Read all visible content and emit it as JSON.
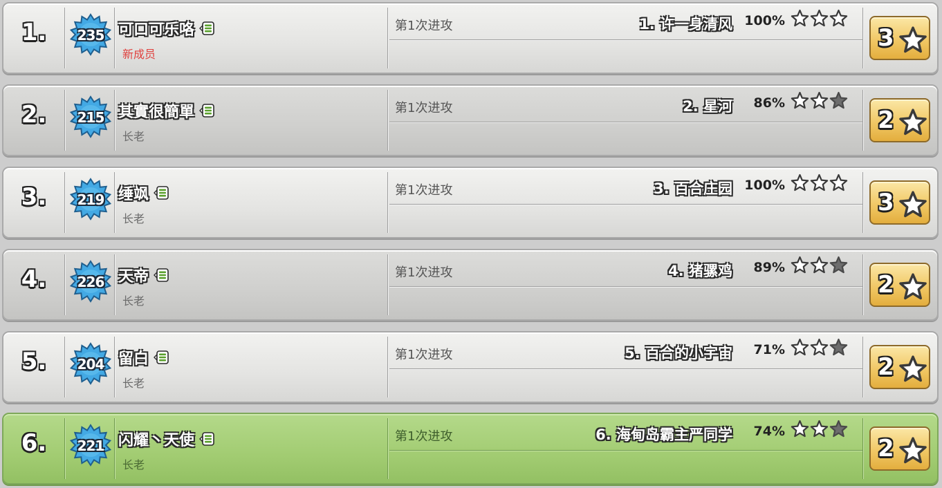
{
  "attack_label": "第1次进攻",
  "colors": {
    "badge_blue": "#43a9e4",
    "highlight_green": "#a2cc72",
    "new_member_red": "#e0413e",
    "total_gold": "#f1c866"
  },
  "icons": {
    "member_list": "list-icon",
    "level_badge": "level-badge-icon",
    "star": "star-icon"
  },
  "members": [
    {
      "rank": "1.",
      "level": "235",
      "name": "可口可乐咯",
      "role": "新成员",
      "is_new": true,
      "highlight": false,
      "target": "1. 许一身清风",
      "percent": "100%",
      "stars": 3,
      "total": "3"
    },
    {
      "rank": "2.",
      "level": "215",
      "name": "其實很簡單",
      "role": "长老",
      "is_new": false,
      "highlight": false,
      "target": "2. 星河",
      "percent": "86%",
      "stars": 2,
      "total": "2"
    },
    {
      "rank": "3.",
      "level": "219",
      "name": "缍飒",
      "role": "长老",
      "is_new": false,
      "highlight": false,
      "target": "3. 百合庄园",
      "percent": "100%",
      "stars": 3,
      "total": "3"
    },
    {
      "rank": "4.",
      "level": "226",
      "name": "天帝",
      "role": "长老",
      "is_new": false,
      "highlight": false,
      "target": "4. 猪骡鸡",
      "percent": "89%",
      "stars": 2,
      "total": "2"
    },
    {
      "rank": "5.",
      "level": "204",
      "name": "留白",
      "role": "长老",
      "is_new": false,
      "highlight": false,
      "target": "5. 百合的小宇宙",
      "percent": "71%",
      "stars": 2,
      "total": "2"
    },
    {
      "rank": "6.",
      "level": "221",
      "name": "闪耀丶天使",
      "role": "长老",
      "is_new": false,
      "highlight": true,
      "target": "6. 海甸岛霸主严同学",
      "percent": "74%",
      "stars": 2,
      "total": "2"
    }
  ]
}
